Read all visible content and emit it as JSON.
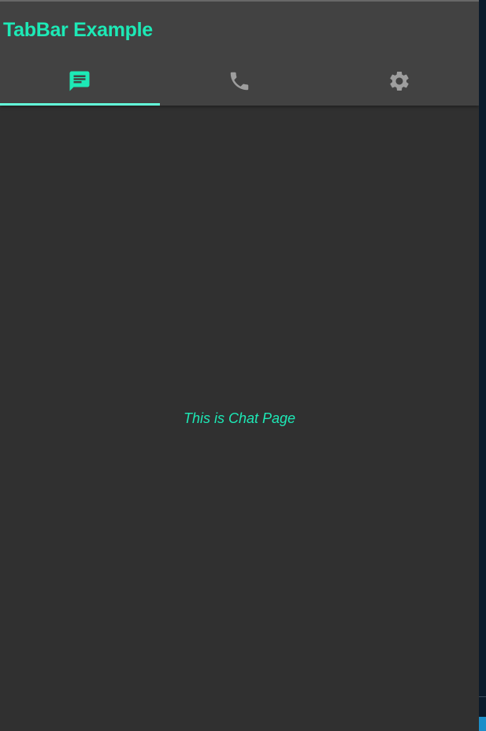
{
  "app_bar": {
    "title": "TabBar Example"
  },
  "tabs": [
    {
      "icon": "chat-icon",
      "selected": true
    },
    {
      "icon": "phone-icon",
      "selected": false
    },
    {
      "icon": "settings-icon",
      "selected": false
    }
  ],
  "body": {
    "text": "This is Chat Page"
  },
  "colors": {
    "accent": "#1de9b6",
    "indicator": "#64ffda",
    "app_bar_bg": "#424242",
    "body_bg": "#303030",
    "inactive_icon": "#9e9e9e"
  }
}
